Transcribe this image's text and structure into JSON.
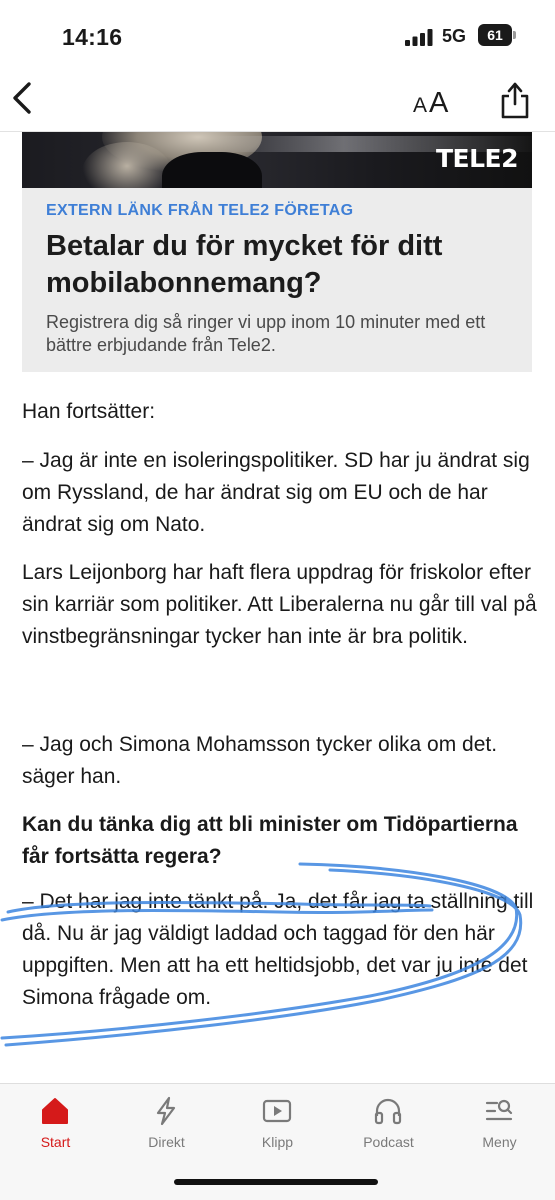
{
  "status_bar": {
    "time": "14:16",
    "network": "5G",
    "battery": "61"
  },
  "nav": {
    "back_icon": "chevron-left-icon",
    "font_size_label": "AA",
    "share_icon": "share-icon"
  },
  "ad": {
    "brand_logo": "TELE2",
    "source": "EXTERN LÄNK FRÅN TELE2 FÖRETAG",
    "title": "Betalar du för mycket för ditt mobilabonnemang?",
    "description": "Registrera dig så ringer vi upp inom 10 minuter med ett bättre erbjudande från Tele2."
  },
  "article": {
    "paragraphs": [
      "Han fortsätter:",
      "– Jag är inte en isoleringspolitiker. SD har ju ändrat sig om Ryssland, de har ändrat sig om EU och de har ändrat sig om Nato.",
      "Lars Leijonborg har haft flera uppdrag för friskolor efter sin karriär som politiker. Att Liberalerna nu går till val på vinstbegränsningar tycker han inte är bra politik.",
      "– Jag och Simona Mohamsson tycker olika om det. säger han.",
      "Kan du tänka dig att bli minister om Tidöpartierna får fortsätta regera?",
      "– Det har jag inte tänkt på. Ja, det får jag ta ställning till då. Nu är jag väldigt laddad och taggad för den här uppgiften. Men att ha ett heltidsjobb, det var ju inte det Simona frågade om."
    ]
  },
  "annotation": {
    "color": "#3d86e0"
  },
  "tab_bar": {
    "active_color": "#d51a1a",
    "items": [
      {
        "label": "Start",
        "icon": "home-icon"
      },
      {
        "label": "Direkt",
        "icon": "lightning-icon"
      },
      {
        "label": "Klipp",
        "icon": "play-icon"
      },
      {
        "label": "Podcast",
        "icon": "headphones-icon"
      },
      {
        "label": "Meny",
        "icon": "menu-search-icon"
      }
    ]
  }
}
